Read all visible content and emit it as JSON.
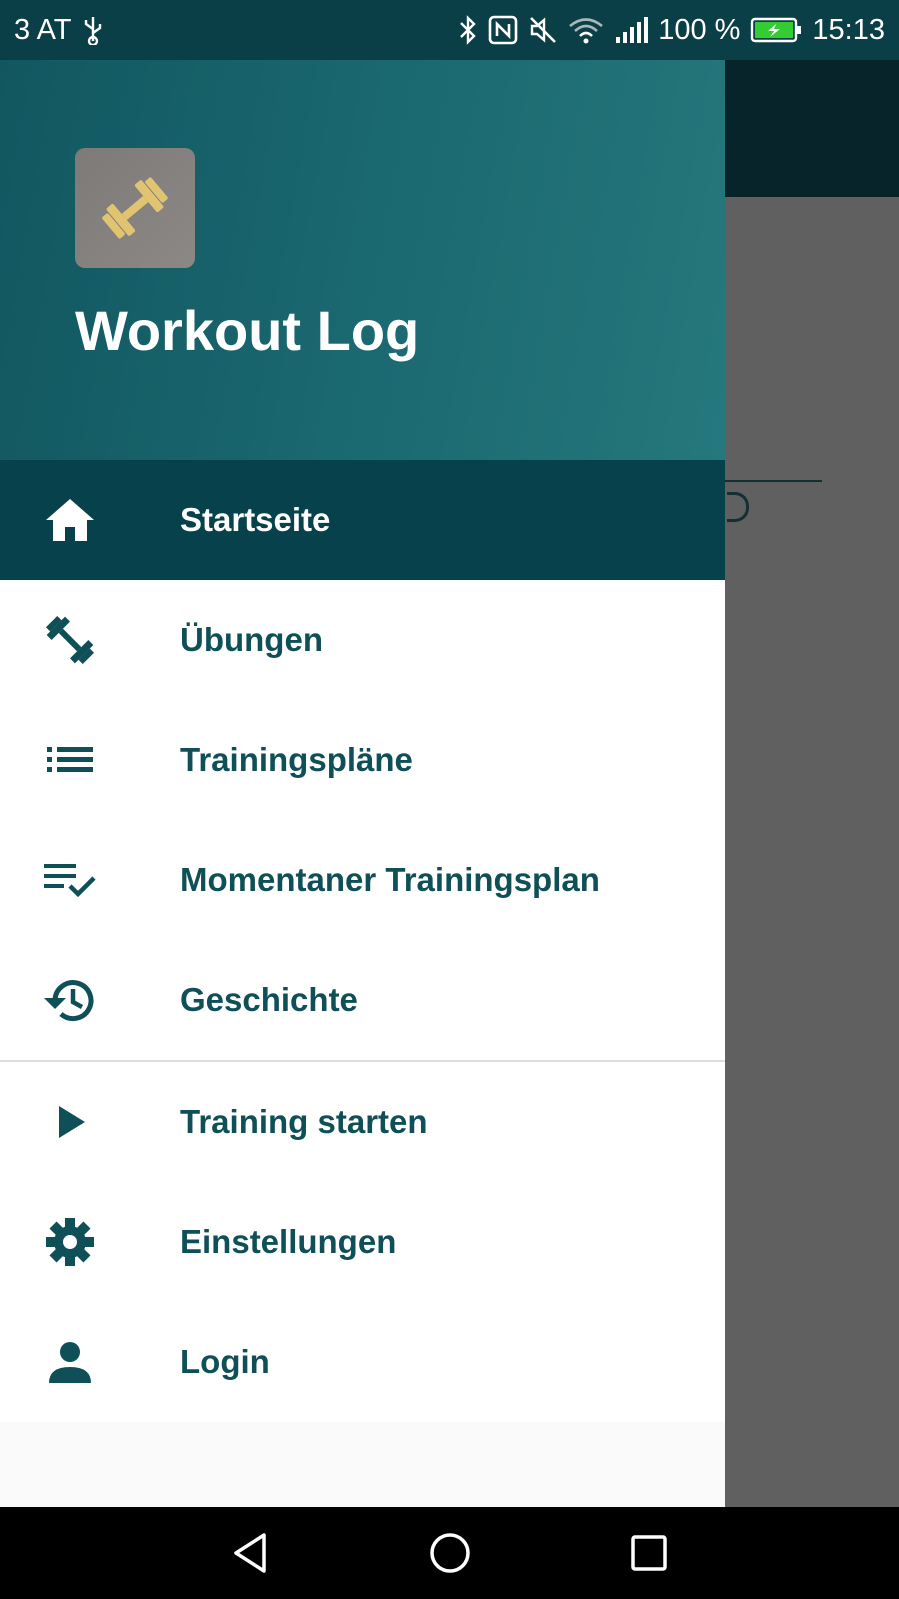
{
  "status_bar": {
    "carrier": "3 AT",
    "battery_percent": "100 %",
    "time": "15:13"
  },
  "drawer": {
    "app_title": "Workout Log",
    "colors": {
      "header_start": "#125760",
      "header_end": "#25787c",
      "active_bg": "#07414b",
      "item_text": "#0f4f58",
      "logo_dumbbell": "#e1c472"
    },
    "primary_items": [
      {
        "label": "Startseite",
        "icon": "home-icon",
        "active": true
      },
      {
        "label": "Übungen",
        "icon": "dumbbell-icon",
        "active": false
      },
      {
        "label": "Trainingspläne",
        "icon": "list-icon",
        "active": false
      },
      {
        "label": "Momentaner Trainingsplan",
        "icon": "playlist-check-icon",
        "active": false
      },
      {
        "label": "Geschichte",
        "icon": "history-icon",
        "active": false
      }
    ],
    "secondary_items": [
      {
        "label": "Training starten",
        "icon": "play-icon"
      },
      {
        "label": "Einstellungen",
        "icon": "gear-icon"
      },
      {
        "label": "Login",
        "icon": "person-icon"
      }
    ]
  },
  "nav_bar": {
    "buttons": [
      "back-icon",
      "home-circle-icon",
      "recents-icon"
    ]
  }
}
